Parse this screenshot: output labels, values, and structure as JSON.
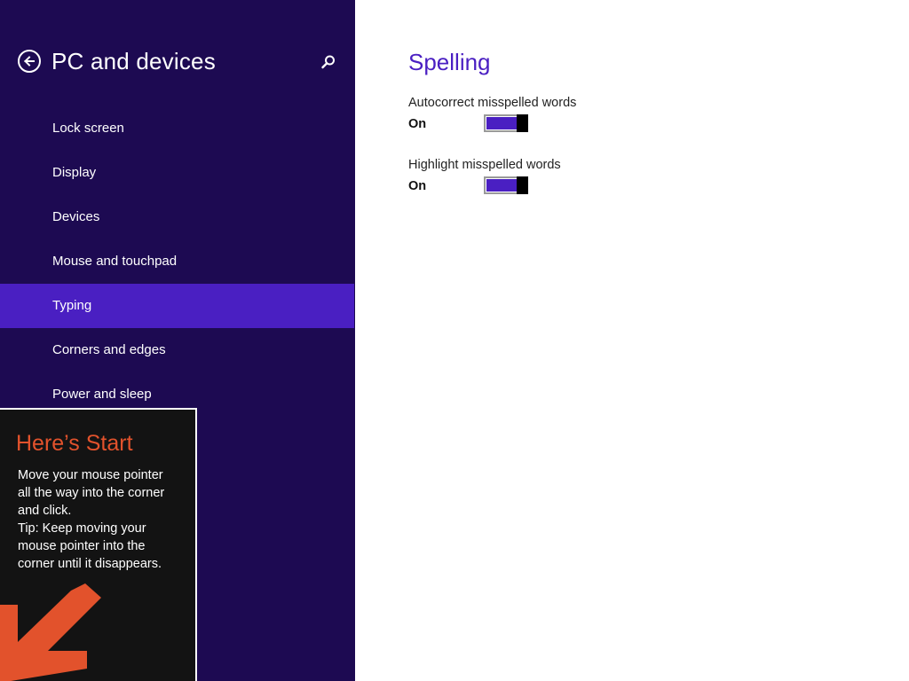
{
  "left_pane": {
    "title": "PC and devices",
    "nav_items": [
      {
        "label": "Lock screen",
        "selected": false
      },
      {
        "label": "Display",
        "selected": false
      },
      {
        "label": "Devices",
        "selected": false
      },
      {
        "label": "Mouse and touchpad",
        "selected": false
      },
      {
        "label": "Typing",
        "selected": true
      },
      {
        "label": "Corners and edges",
        "selected": false
      },
      {
        "label": "Power and sleep",
        "selected": false
      }
    ],
    "icons": {
      "back": "back-arrow-icon",
      "search": "search-icon"
    }
  },
  "start_tip": {
    "title": "Here’s Start",
    "lines": [
      "Move your mouse pointer",
      "all the way into the corner",
      "and click.",
      "Tip: Keep moving your",
      "mouse pointer into the",
      "corner until it disappears."
    ],
    "icon": "arrow-down-left-icon"
  },
  "content": {
    "section_title": "Spelling",
    "settings": [
      {
        "label": "Autocorrect misspelled words",
        "state": "On"
      },
      {
        "label": "Highlight misspelled words",
        "state": "On"
      }
    ]
  },
  "colors": {
    "pane_background": "#1d0a52",
    "accent": "#4a1fc2",
    "tip_title": "#e2522c",
    "tip_background": "#131313"
  }
}
